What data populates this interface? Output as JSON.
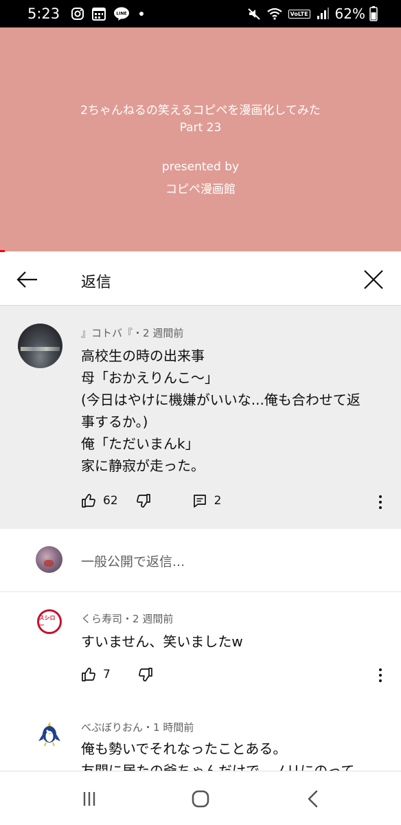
{
  "status_bar": {
    "time": "5:23",
    "battery": "62%",
    "left_icons": [
      "instagram-icon",
      "calendar-icon",
      "line-icon",
      "notification-dot-icon"
    ],
    "right_icons": [
      "mute-icon",
      "wifi-icon",
      "volte-icon",
      "signal-icon",
      "battery-icon"
    ],
    "volte_label": "VoLTE"
  },
  "video": {
    "title_line1": "2ちゃんねるの笑えるコピペを漫画化してみた",
    "title_line2": "Part 23",
    "presented_line1": "presented by",
    "presented_line2": "コピペ漫画館",
    "background_color": "#df9c94"
  },
  "replies_header": {
    "title": "返信"
  },
  "parent_comment": {
    "author": "』コトバ『",
    "separator": "・",
    "time": "2 週間前",
    "lines": [
      "高校生の時の出来事",
      "母「おかえりんこ〜」",
      "(今日はやけに機嫌がいいな...俺も合わせて返",
      "事するか。)",
      "俺「ただいまんk」",
      "家に静寂が走った。"
    ],
    "likes": "62",
    "replies": "2"
  },
  "reply_input": {
    "placeholder": "一般公開で返信..."
  },
  "replies": [
    {
      "author": "くら寿司",
      "separator": "・",
      "time": "2 週間前",
      "text": "すいません、笑いましたw",
      "likes": "7",
      "logo_text": "スシロー"
    },
    {
      "author": "べぶぼりおん",
      "separator": "・",
      "time": "1 時間前",
      "text": "俺も勢いでそれなったことある。",
      "text2": "友関に居たの爺ちゃんだけで、ノリにのって"
    }
  ],
  "nav": {
    "icons": [
      "recent-apps-icon",
      "home-icon",
      "back-icon"
    ]
  },
  "colors": {
    "accent_red": "#ff0000",
    "secondary_text": "#606060",
    "comment_bg": "#eeeeee"
  }
}
